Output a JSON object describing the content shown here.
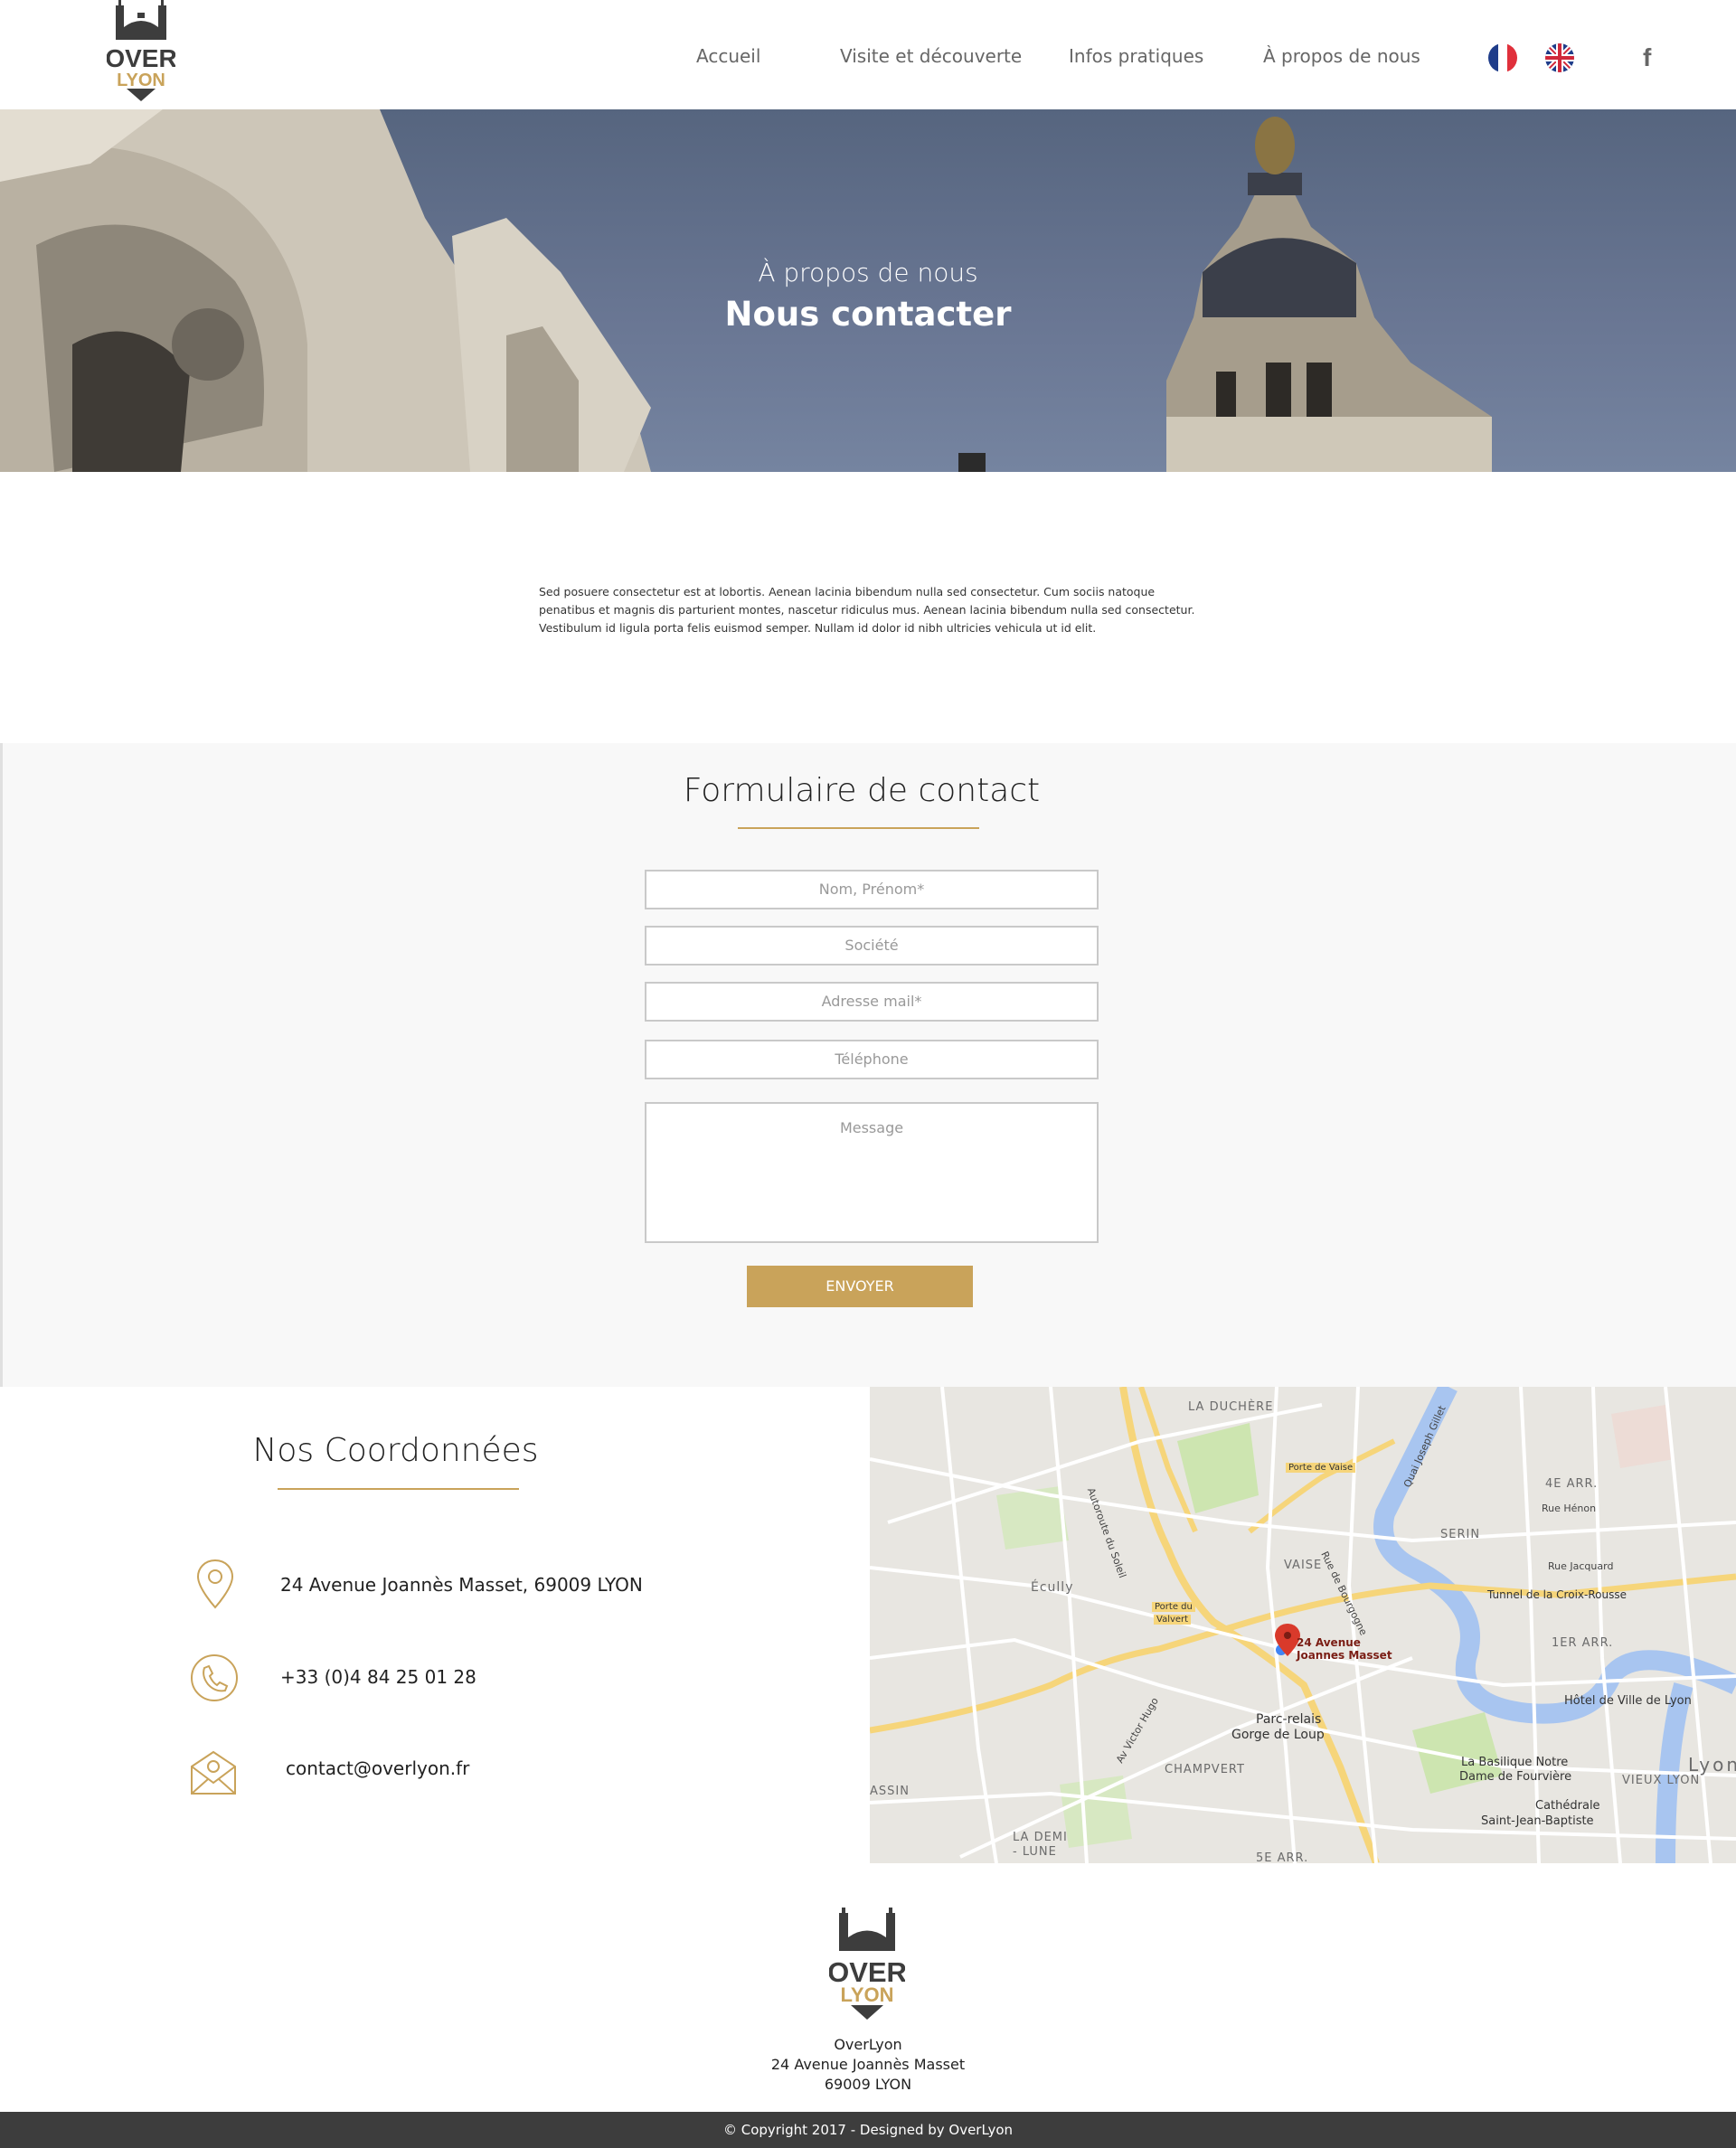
{
  "brand": {
    "logo_top": "OVER",
    "logo_bottom": "LYON",
    "accent_color": "#c9a35a",
    "dark_color": "#3d3d3d"
  },
  "nav": {
    "items": [
      {
        "label": "Accueil"
      },
      {
        "label": "Visite et découverte"
      },
      {
        "label": "Infos pratiques"
      },
      {
        "label": "À propos de nous"
      }
    ],
    "languages": [
      "french-flag-icon",
      "uk-flag-icon"
    ],
    "social": "f"
  },
  "hero": {
    "subtitle": "À propos de nous",
    "title": "Nous contacter"
  },
  "intro": {
    "text": "Sed posuere consectetur est at lobortis. Aenean lacinia bibendum nulla sed consectetur. Cum sociis natoque penatibus et magnis dis parturient montes, nascetur ridiculus mus. Aenean lacinia bibendum nulla sed consectetur. Vestibulum id ligula porta felis euismod semper. Nullam id dolor id nibh ultricies vehicula ut id elit."
  },
  "form": {
    "title": "Formulaire de contact",
    "fields": {
      "name": "Nom, Prénom*",
      "company": "Société",
      "email": "Adresse mail*",
      "phone": "Téléphone",
      "message": "Message"
    },
    "submit": "ENVOYER"
  },
  "coordinates": {
    "title": "Nos Coordonnées",
    "address": "24 Avenue Joannès Masset, 69009 LYON",
    "phone": "+33 (0)4 84 25 01 28",
    "email": "contact@overlyon.fr"
  },
  "map": {
    "marker_label_line1": "24 Avenue",
    "marker_label_line2": "Joannes Masset",
    "labels": {
      "duchere": "LA DUCHÈRE",
      "ecully": "Écully",
      "vaise": "VAISE",
      "serin": "SERIN",
      "arr4": "4E ARR.",
      "arr1": "1ER ARR.",
      "arr5": "5E ARR.",
      "champvert": "CHAMPVERT",
      "lademi": "LA DEMI",
      "lune": "- LUNE",
      "tunnel": "Tunnel de la Croix-Rousse",
      "hotel": "Hôtel de Ville de Lyon",
      "parc1": "Parc-relais",
      "parc2": "Gorge de Loup",
      "basilique1": "La Basilique Notre",
      "basilique2": "Dame de Fourvière",
      "vieux": "VIEUX LYON",
      "cath1": "Cathédrale",
      "cath2": "Saint-Jean-Baptiste",
      "lyon": "Lyon",
      "porte_vaise": "Porte de Vaise",
      "porte_valvert1": "Porte du",
      "porte_valvert2": "Valvert",
      "assin": "ASSIN",
      "rue_bourgogne": "Rue de Bourgogne",
      "autoroute": "Autoroute du Soleil",
      "victor_hugo": "Av Victor Hugo",
      "quai_gillet": "Quai Joseph Gillet",
      "rue_henon": "Rue Hénon",
      "rue_jacquard": "Rue Jacquard"
    }
  },
  "footer": {
    "name": "OverLyon",
    "street": "24 Avenue Joannès Masset",
    "city": "69009 LYON",
    "copyright": "© Copyright 2017 - Designed by OverLyon"
  }
}
